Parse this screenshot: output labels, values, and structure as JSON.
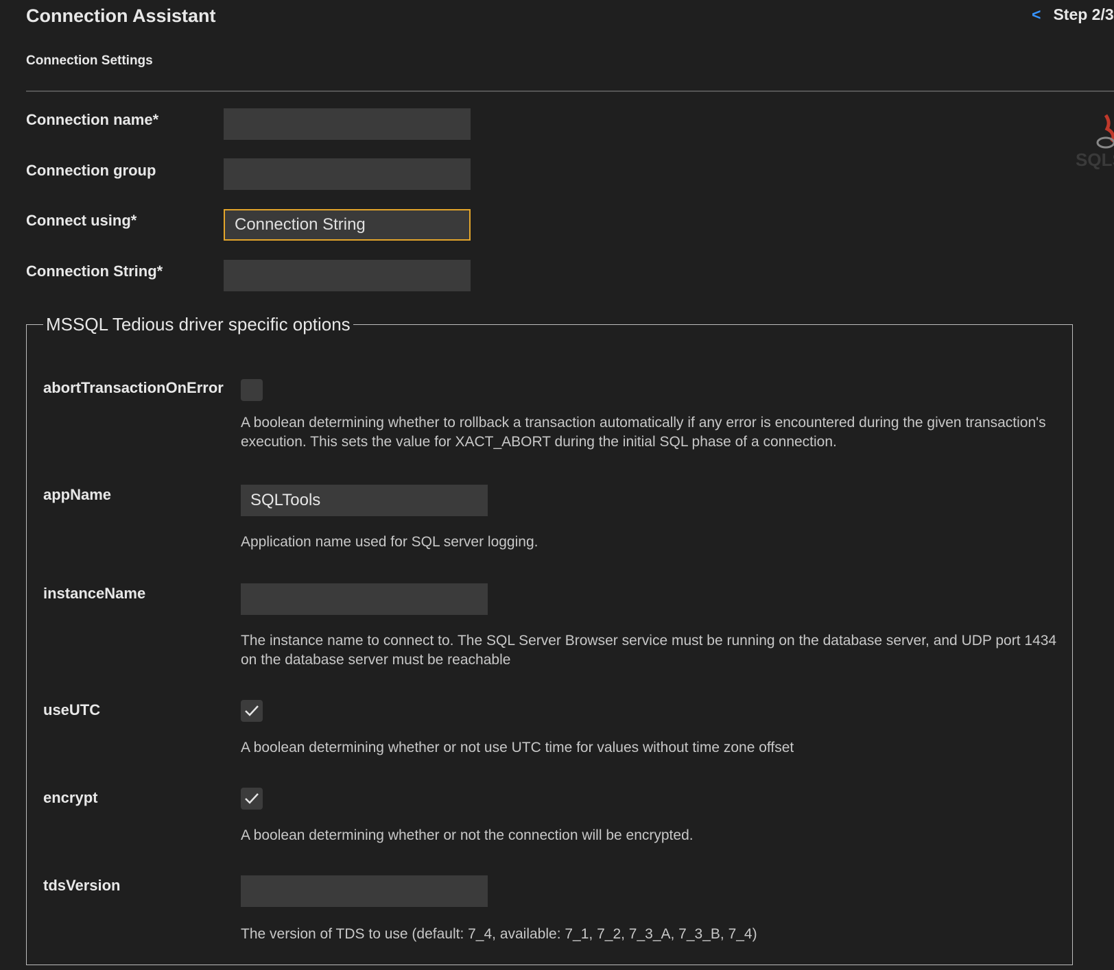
{
  "header": {
    "title": "Connection Assistant",
    "back_glyph": "<",
    "step": "Step 2/3"
  },
  "section": {
    "subtitle": "Connection Settings"
  },
  "form": {
    "connection_name": {
      "label": "Connection name*",
      "value": ""
    },
    "connection_group": {
      "label": "Connection group",
      "value": ""
    },
    "connect_using": {
      "label": "Connect using*",
      "value": "Connection String"
    },
    "connection_string": {
      "label": "Connection String*",
      "value": ""
    }
  },
  "driver_options": {
    "legend": "MSSQL Tedious driver specific options",
    "abortTransactionOnError": {
      "label": "abortTransactionOnError",
      "checked": false,
      "description": "A boolean determining whether to rollback a transaction automatically if any error is encountered during the given transaction's execution. This sets the value for XACT_ABORT during the initial SQL phase of a connection."
    },
    "appName": {
      "label": "appName",
      "value": "SQLTools",
      "description": "Application name used for SQL server logging."
    },
    "instanceName": {
      "label": "instanceName",
      "value": "",
      "description": "The instance name to connect to. The SQL Server Browser service must be running on the database server, and UDP port 1434 on the database server must be reachable"
    },
    "useUTC": {
      "label": "useUTC",
      "checked": true,
      "description": "A boolean determining whether or not use UTC time for values without time zone offset"
    },
    "encrypt": {
      "label": "encrypt",
      "checked": true,
      "description": "A boolean determining whether or not the connection will be encrypted."
    },
    "tdsVersion": {
      "label": "tdsVersion",
      "value": "",
      "description": "The version of TDS to use (default: 7_4, available: 7_1, 7_2, 7_3_A, 7_3_B, 7_4)"
    }
  },
  "icons": {
    "logo": "sql-server-logo-icon",
    "checkmark": "checkmark-icon"
  },
  "colors": {
    "background": "#1f1f1f",
    "input_background": "#3b3b3b",
    "focus_border": "#e3a52b",
    "link": "#3794ff"
  }
}
